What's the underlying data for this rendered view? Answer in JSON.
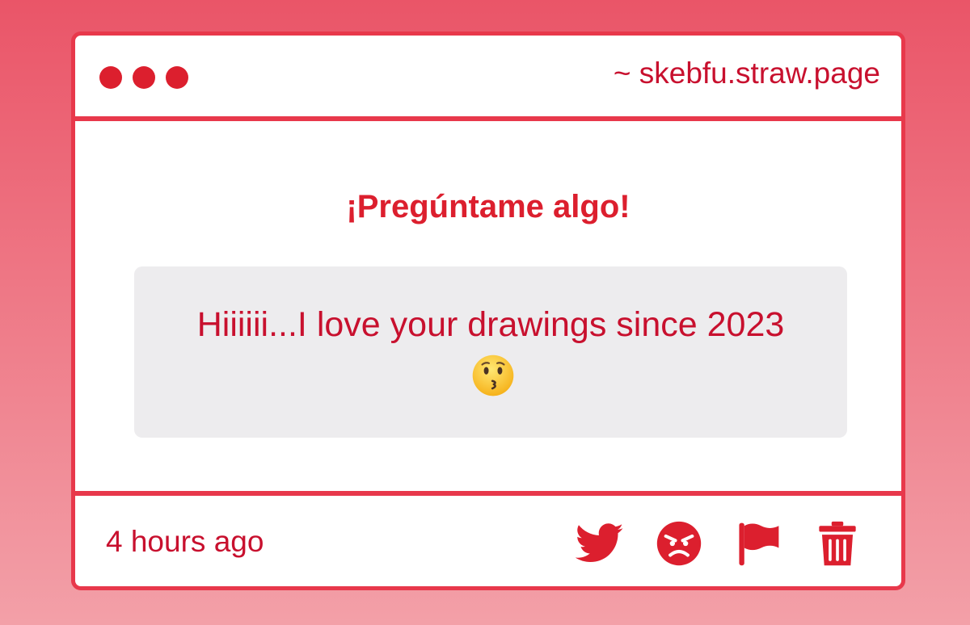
{
  "window": {
    "url": "~ skebfu.straw.page"
  },
  "card": {
    "heading": "¡Pregúntame algo!",
    "message": "Hiiiiii...I love your drawings since 2023",
    "message_emoji": "kissing-face-emoji"
  },
  "footer": {
    "time": "4 hours ago",
    "actions": [
      {
        "icon": "twitter-bird-icon"
      },
      {
        "icon": "angry-face-icon"
      },
      {
        "icon": "flag-icon"
      },
      {
        "icon": "trash-icon"
      }
    ]
  },
  "colors": {
    "accent": "#e8384b",
    "text": "#c8102e",
    "message_bg": "#edecee"
  }
}
